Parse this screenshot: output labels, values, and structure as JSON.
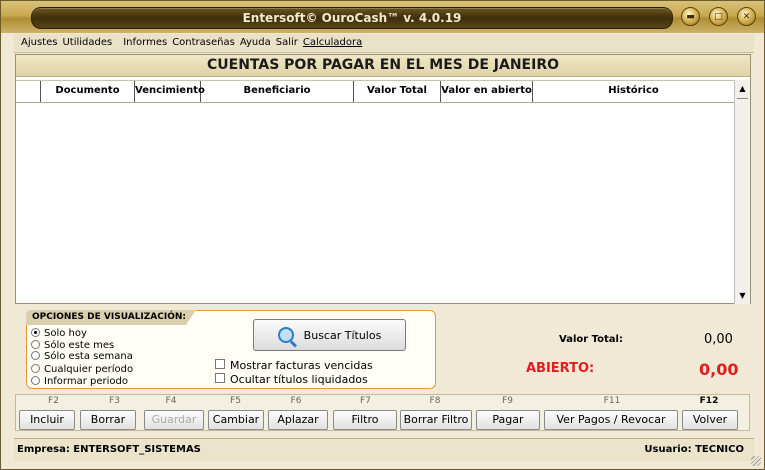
{
  "window": {
    "title": "Entersoft© OuroCash™ v. 4.0.19"
  },
  "menu": [
    {
      "label": "Ajustes"
    },
    {
      "label": "Utilidades"
    },
    {
      "label": "Informes"
    },
    {
      "label": "Contraseñas"
    },
    {
      "label": "Ayuda"
    },
    {
      "label": "Salir"
    },
    {
      "label": "Calculadora"
    }
  ],
  "table": {
    "title": "CUENTAS POR PAGAR EN EL MES DE JANEIRO",
    "columns": [
      "",
      "Documento",
      "Vencimiento",
      "Beneficiario",
      "Valor Total",
      "Valor en abierto",
      "Histórico"
    ],
    "rows": []
  },
  "options": {
    "legend": "OPCIONES DE VISUALIZACIÓN:",
    "radios": [
      {
        "label": "Solo hoy",
        "selected": true
      },
      {
        "label": "Sólo este mes",
        "selected": false
      },
      {
        "label": "Sólo esta semana",
        "selected": false
      },
      {
        "label": "Cualquier período",
        "selected": false
      },
      {
        "label": "Informar periodo",
        "selected": false
      }
    ],
    "search_button": "Buscar Títulos",
    "checks": [
      {
        "label": "Mostrar facturas vencidas",
        "checked": false
      },
      {
        "label": "Ocultar títulos liquidados",
        "checked": false
      }
    ]
  },
  "totals": {
    "total_label": "Valor Total:",
    "total_value": "0,00",
    "open_label": "ABIERTO:",
    "open_value": "0,00",
    "open_color": "#e01e1e"
  },
  "fkeys": [
    {
      "key": "F2",
      "label": "Incluir",
      "enabled": true
    },
    {
      "key": "F3",
      "label": "Borrar",
      "enabled": true
    },
    {
      "key": "F4",
      "label": "Guardar",
      "enabled": false
    },
    {
      "key": "F5",
      "label": "Cambiar",
      "enabled": true
    },
    {
      "key": "F6",
      "label": "Aplazar",
      "enabled": true
    },
    {
      "key": "F7",
      "label": "Filtro",
      "enabled": true
    },
    {
      "key": "F8",
      "label": "Borrar Filtro",
      "enabled": true
    },
    {
      "key": "F9",
      "label": "Pagar",
      "enabled": true
    },
    {
      "key": "F11",
      "label": "Ver Pagos / Revocar",
      "enabled": true
    },
    {
      "key": "F12",
      "label": "Volver",
      "enabled": true
    }
  ],
  "status": {
    "company": "Empresa: ENTERSOFT_SISTEMAS",
    "user": "Usuario: TECNICO"
  }
}
